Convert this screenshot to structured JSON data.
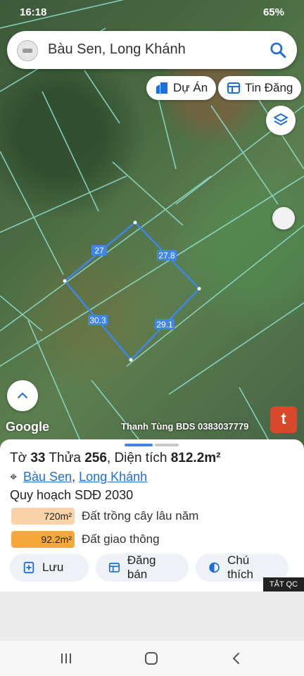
{
  "status": {
    "time": "16:18",
    "battery": "65%"
  },
  "search": {
    "query": "Bàu Sen, Long Khánh"
  },
  "chips": {
    "projects": "Dự Án",
    "listings": "Tin Đăng"
  },
  "map": {
    "plot_edges": [
      "27",
      "27.8",
      "29.1",
      "30.3"
    ],
    "attribution": "Thanh Tùng BDS 0383037779",
    "brand": "Google",
    "t_button": "t"
  },
  "sheet": {
    "title_prefix": "Tờ ",
    "sheet_no": "33",
    "plot_label": " Thửa ",
    "plot_no": "256",
    "area_label": ", Diện tích ",
    "area": "812.2m²",
    "location_1": "Bàu Sen",
    "location_sep": ", ",
    "location_2": "Long Khánh",
    "planning": "Quy hoạch SDĐ 2030",
    "land_uses": [
      {
        "area": "720m²",
        "label": "Đất trồng cây lâu năm",
        "color": "#fbd3a8"
      },
      {
        "area": "92.2m²",
        "label": "Đất giao thông",
        "color": "#f5a93a"
      }
    ],
    "actions": {
      "save": "Lưu",
      "post": "Đăng bán",
      "legend": "Chú thích"
    }
  },
  "ad": {
    "hide": "TẮT QC"
  }
}
